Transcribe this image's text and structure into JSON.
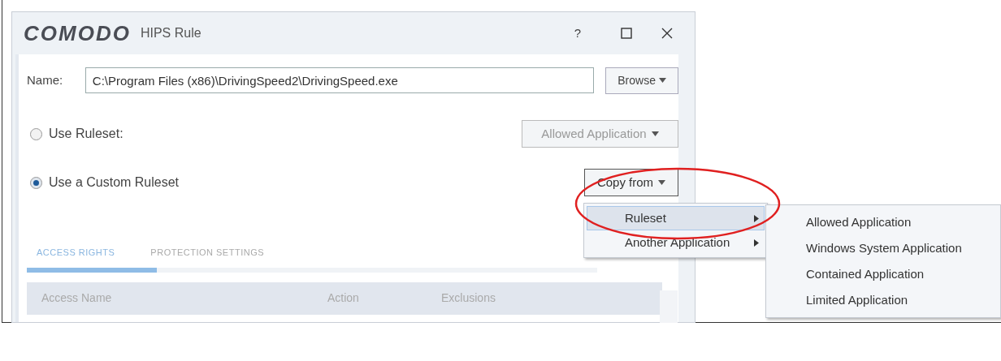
{
  "window": {
    "logo": "COMODO",
    "title": "HIPS Rule",
    "help": "?"
  },
  "name_field": {
    "label": "Name:",
    "value": "C:\\Program Files (x86)\\DrivingSpeed2\\DrivingSpeed.exe"
  },
  "browse_button": {
    "label": "Browse"
  },
  "options": [
    {
      "label": "Use Ruleset:",
      "selected": false,
      "kind": "dropdown",
      "control": {
        "label": "Allowed Application",
        "disabled": true
      }
    },
    {
      "label": "Use a Custom Ruleset",
      "selected": true,
      "kind": "button",
      "control": {
        "label": "Copy from",
        "disabled": false
      }
    }
  ],
  "copy_menu": {
    "items": [
      {
        "label": "Ruleset",
        "selected": true
      },
      {
        "label": "Another Application",
        "selected": false
      }
    ]
  },
  "submenu": {
    "items": [
      {
        "label": "Allowed Application"
      },
      {
        "label": "Windows System Application"
      },
      {
        "label": "Contained Application"
      },
      {
        "label": "Limited Application"
      }
    ]
  },
  "tabs": [
    {
      "label": "ACCESS RIGHTS",
      "selected": true
    },
    {
      "label": "PROTECTION SETTINGS",
      "selected": false
    }
  ],
  "table": {
    "columns": [
      "Access Name",
      "Action",
      "Exclusions"
    ]
  }
}
